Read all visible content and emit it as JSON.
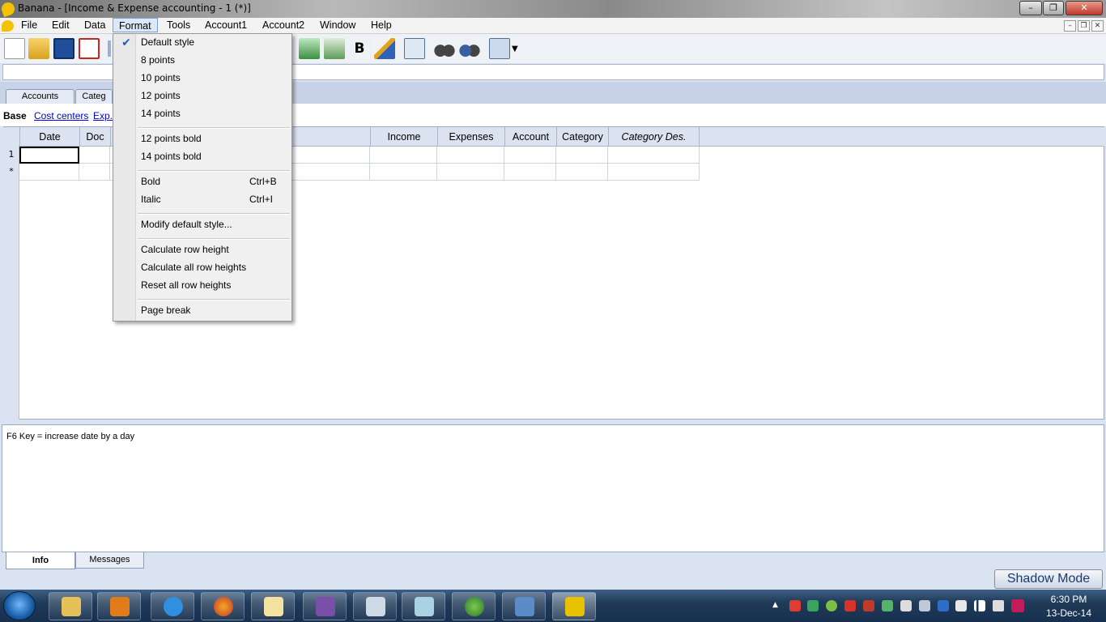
{
  "window": {
    "title": "Banana - [Income & Expense accounting - 1 (*)]"
  },
  "menubar": {
    "items": [
      "File",
      "Edit",
      "Data",
      "Format",
      "Tools",
      "Account1",
      "Account2",
      "Window",
      "Help"
    ],
    "active": "Format"
  },
  "table_tabs": [
    "Accounts",
    "Categ"
  ],
  "views": [
    "Base",
    "Cost centers",
    "Exp."
  ],
  "table": {
    "columns": [
      "Date",
      "Doc",
      "Income",
      "Expenses",
      "Account",
      "Category",
      "Category Des."
    ],
    "rows": [
      "1",
      "*"
    ]
  },
  "info": {
    "text": "F6 Key = increase date by a day"
  },
  "bottom_tabs": [
    "Info",
    "Messages"
  ],
  "shadow_mode": "Shadow Mode",
  "format_menu": {
    "items": [
      {
        "label": "Default style",
        "checked": true
      },
      {
        "label": "8 points"
      },
      {
        "label": "10 points"
      },
      {
        "label": "12 points"
      },
      {
        "label": "14 points"
      },
      {
        "label": "12 points bold"
      },
      {
        "label": "14 points bold"
      },
      {
        "label": "Bold",
        "shortcut": "Ctrl+B"
      },
      {
        "label": "Italic",
        "shortcut": "Ctrl+I"
      },
      {
        "label": "Modify default style..."
      },
      {
        "label": "Calculate row height"
      },
      {
        "label": "Calculate all row heights"
      },
      {
        "label": "Reset all row heights"
      },
      {
        "label": "Page break"
      }
    ]
  },
  "toolbar": {
    "bold_label": "B"
  },
  "clock": {
    "time": "6:30 PM",
    "date": "13-Dec-14"
  },
  "colors": {
    "accent": "#1d5fb5",
    "taskbar": "#203a58",
    "tab_bg": "#c8d3e8"
  }
}
